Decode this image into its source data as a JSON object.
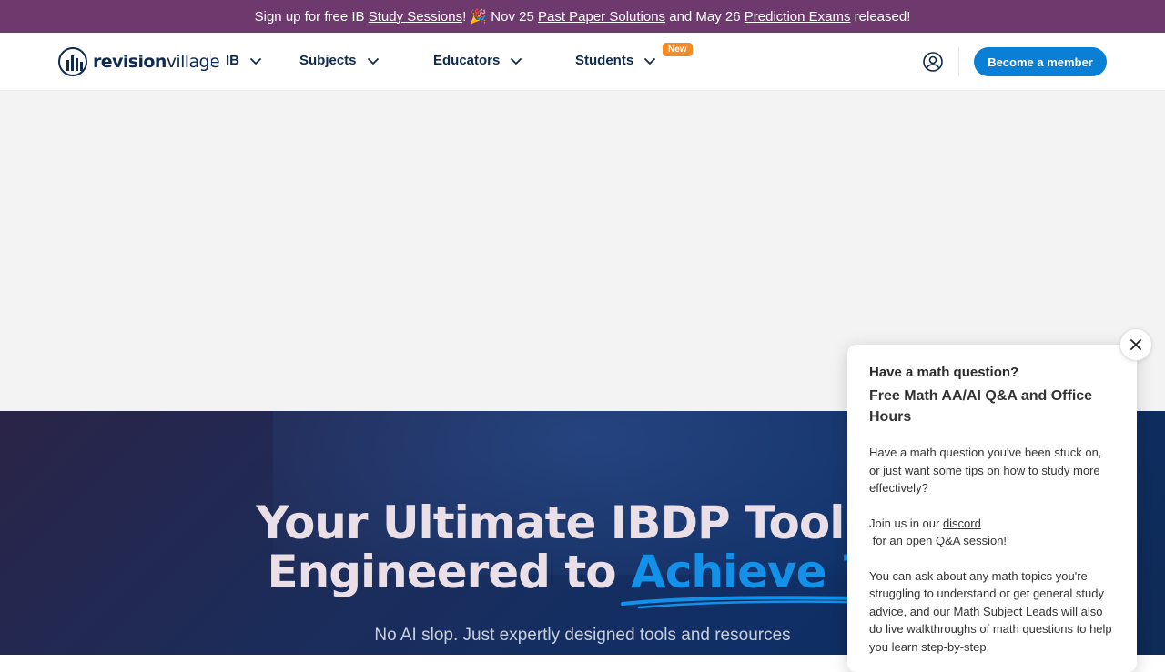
{
  "announcement": {
    "prefix": "Sign up for free IB ",
    "link1": "Study Sessions",
    "mid1": "! 🎉 Nov 25 ",
    "link2": "Past Paper Solutions",
    "mid2": " and May 26 ",
    "link3": "Prediction Exams",
    "suffix": " released!"
  },
  "header": {
    "logo_bold": "revision",
    "logo_light": "village",
    "nav": {
      "ib": "IB",
      "subjects": "Subjects",
      "educators": "Educators",
      "students": "Students",
      "students_badge": "New"
    },
    "account_icon": "user-circle-icon",
    "cta": "Become a member"
  },
  "hero": {
    "title_line1": "Your Ultimate IBDP Toolkit",
    "title_line2_prefix": "Engineered to ",
    "title_line2_accent": "Achieve 7s",
    "subtitle": "No AI slop. Just expertly designed tools and resources"
  },
  "chat": {
    "heading": "Have a math question?",
    "title": "Free Math AA/AI Q&A and Office Hours",
    "para1": "Have a math question you've been stuck on, or just want some tips on how to study more effectively?",
    "para2_prefix": "Join us in our ",
    "para2_link": "discord",
    "para2_suffix": " for an open Q&A session!",
    "para3": "You can ask about any math topics you're struggling to understand or get general study advice, and our Math Subject Leads will also do live walkthroughs of math questions to help you learn step-by-step."
  },
  "colors": {
    "announcement_bg": "#6e3a6e",
    "brand_navy": "#0e2a4d",
    "accent_blue": "#0a7fd6",
    "badge_orange": "#f28c28"
  }
}
